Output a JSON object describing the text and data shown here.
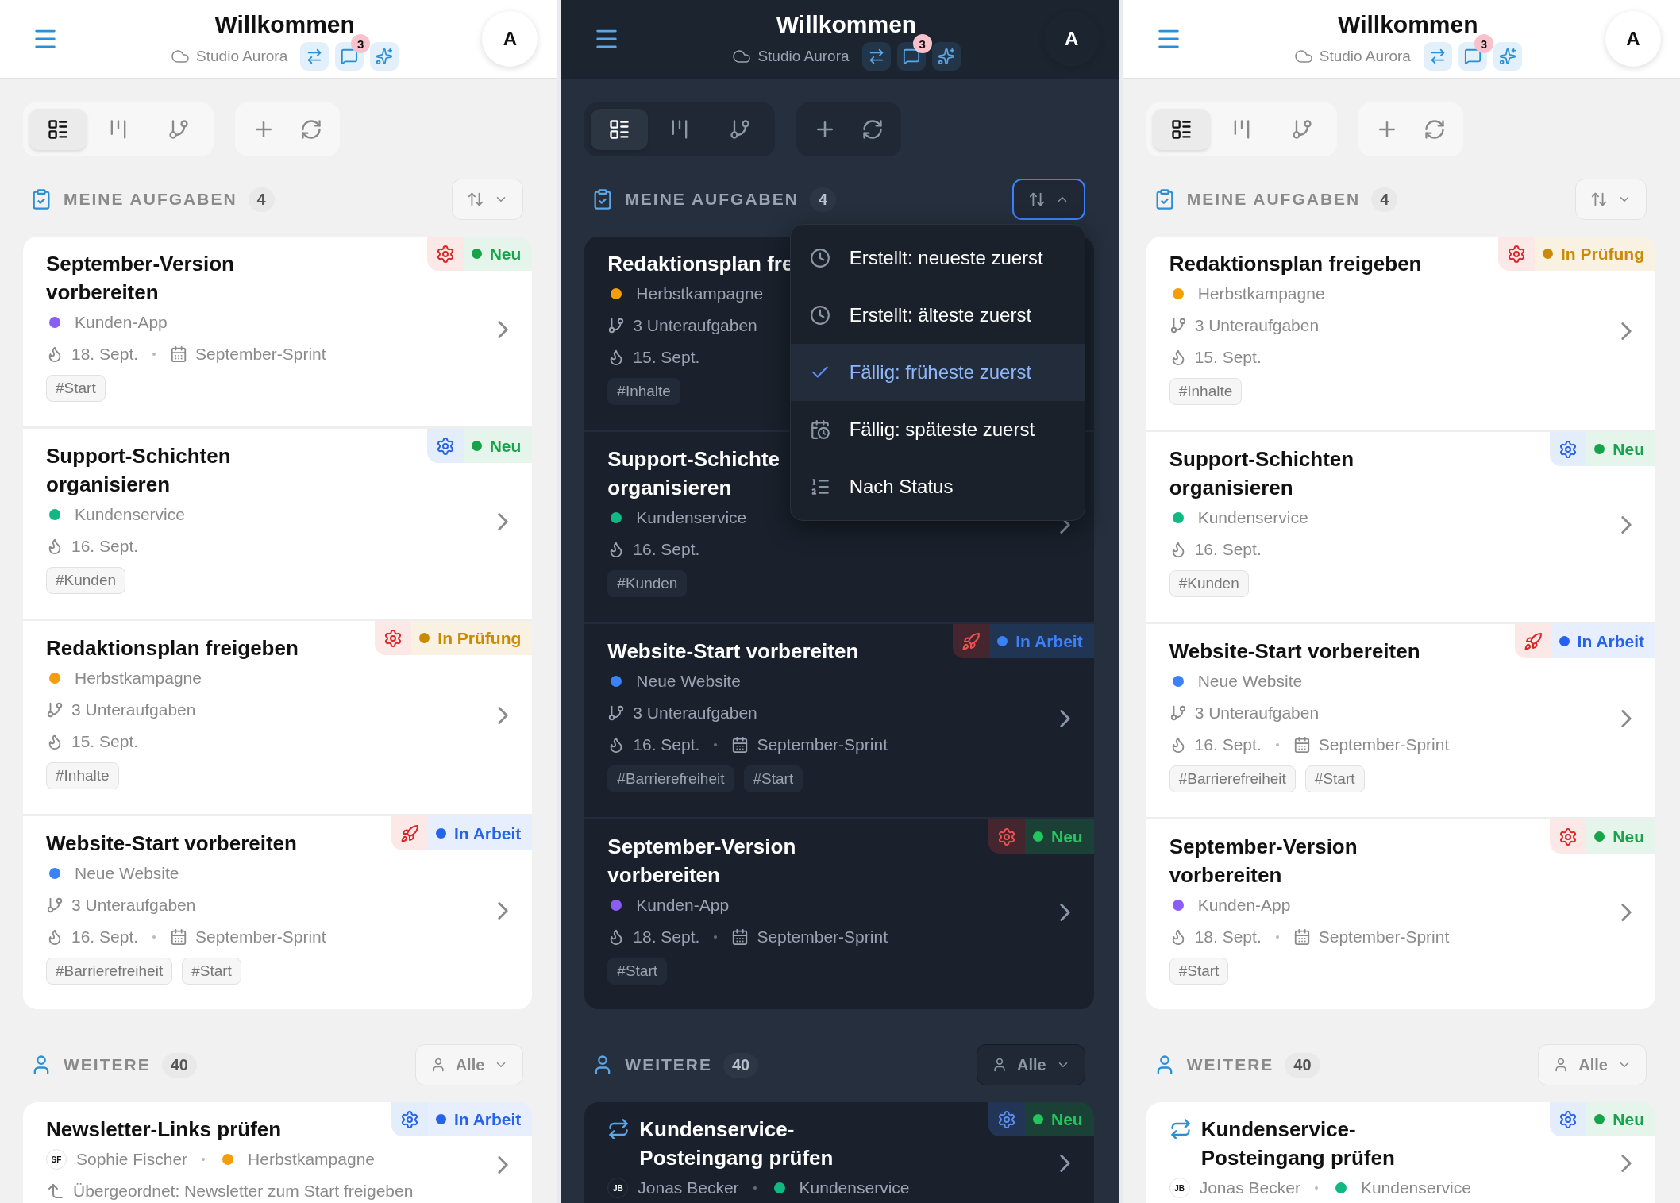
{
  "panels": [
    {
      "kind": "light",
      "header": {
        "title": "Willkommen",
        "workspace": "Studio Aurora",
        "message_count": "3",
        "avatar": "A"
      },
      "toolbar": {
        "views": [
          {
            "kind": "list",
            "selected": true
          },
          {
            "kind": "board",
            "selected": false
          },
          {
            "kind": "tree",
            "selected": false
          }
        ]
      },
      "my_tasks": {
        "title": "MEINE AUFGABEN",
        "count": "4",
        "sort": {
          "open": false
        }
      },
      "tasks": [
        {
          "title": "September-Version vorbereiten",
          "badge": {
            "urgent": true,
            "kind": "gear",
            "status": "Neu",
            "color": "#16a34a"
          },
          "project": {
            "name": "Kunden-App",
            "color": "#8b5cf6"
          },
          "due": "18. Sept.",
          "sprint": "September-Sprint",
          "tags": [
            "#Start"
          ]
        },
        {
          "title": "Support-Schichten organisieren",
          "badge": {
            "urgent": false,
            "kind": "gear",
            "status": "Neu",
            "color": "#16a34a"
          },
          "project": {
            "name": "Kundenservice",
            "color": "#10b981"
          },
          "due": "16. Sept.",
          "tags": [
            "#Kunden"
          ]
        },
        {
          "title": "Redaktionsplan freigeben",
          "badge": {
            "urgent": true,
            "kind": "gear",
            "status": "In Prüfung",
            "color": "#ca8a04"
          },
          "project": {
            "name": "Herbstkampagne",
            "color": "#f59e0b"
          },
          "subtasks": "3 Unteraufgaben",
          "due": "15. Sept.",
          "tags": [
            "#Inhalte"
          ]
        },
        {
          "title": "Website-Start vorbereiten",
          "badge": {
            "urgent": true,
            "kind": "rocket",
            "status": "In Arbeit",
            "color": "#2563eb"
          },
          "project": {
            "name": "Neue Website",
            "color": "#3b82f6"
          },
          "subtasks": "3 Unteraufgaben",
          "due": "16. Sept.",
          "sprint": "September-Sprint",
          "tags": [
            "#Barrierefreiheit",
            "#Start"
          ]
        }
      ],
      "others": {
        "title": "WEITERE",
        "count": "40",
        "filter": "Alle"
      },
      "other_tasks": [
        {
          "title": "Newsletter-Links prüfen",
          "badge": {
            "urgent": false,
            "kind": "gear",
            "status": "In Arbeit",
            "color": "#2563eb"
          },
          "assignee": {
            "initials": "SF",
            "name": "Sophie Fischer"
          },
          "project": {
            "name": "Herbstkampagne",
            "color": "#f59e0b"
          },
          "parent": "Übergeordnet: Newsletter zum Start freigeben"
        }
      ]
    },
    {
      "kind": "dark",
      "header": {
        "title": "Willkommen",
        "workspace": "Studio Aurora",
        "message_count": "3",
        "avatar": "A"
      },
      "toolbar": {
        "views": [
          {
            "kind": "list",
            "selected": true
          },
          {
            "kind": "board",
            "selected": false
          },
          {
            "kind": "tree",
            "selected": false
          }
        ]
      },
      "my_tasks": {
        "title": "MEINE AUFGABEN",
        "count": "4",
        "sort": {
          "open": true,
          "options": [
            {
              "label": "Erstellt: neueste zuerst",
              "kind": "clock",
              "selected": false
            },
            {
              "label": "Erstellt: älteste zuerst",
              "kind": "clock",
              "selected": false
            },
            {
              "label": "Fällig: früheste zuerst",
              "selected": true
            },
            {
              "label": "Fällig: späteste zuerst",
              "kind": "calendar",
              "selected": false
            },
            {
              "label": "Nach Status",
              "kind": "list",
              "selected": false
            }
          ]
        }
      },
      "tasks": [
        {
          "title": "Redaktionsplan fre",
          "chevron_hidden": true,
          "project": {
            "name": "Herbstkampagne",
            "color": "#f59e0b"
          },
          "subtasks": "3 Unteraufgaben",
          "due": "15. Sept.",
          "tags": [
            "#Inhalte"
          ]
        },
        {
          "title": "Support-Schichte\norganisieren",
          "project": {
            "name": "Kundenservice",
            "color": "#10b981"
          },
          "due": "16. Sept.",
          "tags": [
            "#Kunden"
          ]
        },
        {
          "title": "Website-Start vorbereiten",
          "badge": {
            "urgent": true,
            "kind": "rocket",
            "status": "In Arbeit",
            "color": "#3b82f6"
          },
          "project": {
            "name": "Neue Website",
            "color": "#3b82f6"
          },
          "subtasks": "3 Unteraufgaben",
          "due": "16. Sept.",
          "sprint": "September-Sprint",
          "tags": [
            "#Barrierefreiheit",
            "#Start"
          ]
        },
        {
          "title": "September-Version vorbereiten",
          "badge": {
            "urgent": true,
            "kind": "gear",
            "status": "Neu",
            "color": "#22c55e"
          },
          "project": {
            "name": "Kunden-App",
            "color": "#8b5cf6"
          },
          "due": "18. Sept.",
          "sprint": "September-Sprint",
          "tags": [
            "#Start"
          ]
        }
      ],
      "others": {
        "title": "WEITERE",
        "count": "40",
        "filter": "Alle"
      },
      "other_tasks": [
        {
          "title": "Kundenservice-Posteingang prüfen",
          "recurring": true,
          "badge": {
            "urgent": false,
            "kind": "gear",
            "status": "Neu",
            "color": "#22c55e"
          },
          "assignee": {
            "initials": "JB",
            "name": "Jonas Becker"
          },
          "project": {
            "name": "Kundenservice",
            "color": "#10b981"
          }
        }
      ]
    },
    {
      "kind": "light",
      "header": {
        "title": "Willkommen",
        "workspace": "Studio Aurora",
        "message_count": "3",
        "avatar": "A"
      },
      "toolbar": {
        "views": [
          {
            "kind": "list",
            "selected": true
          },
          {
            "kind": "board",
            "selected": false
          },
          {
            "kind": "tree",
            "selected": false
          }
        ]
      },
      "my_tasks": {
        "title": "MEINE AUFGABEN",
        "count": "4",
        "sort": {
          "open": false
        }
      },
      "tasks": [
        {
          "title": "Redaktionsplan freigeben",
          "badge": {
            "urgent": true,
            "kind": "gear",
            "status": "In Prüfung",
            "color": "#ca8a04"
          },
          "project": {
            "name": "Herbstkampagne",
            "color": "#f59e0b"
          },
          "subtasks": "3 Unteraufgaben",
          "due": "15. Sept.",
          "tags": [
            "#Inhalte"
          ]
        },
        {
          "title": "Support-Schichten organisieren",
          "badge": {
            "urgent": false,
            "kind": "gear",
            "status": "Neu",
            "color": "#16a34a"
          },
          "project": {
            "name": "Kundenservice",
            "color": "#10b981"
          },
          "due": "16. Sept.",
          "tags": [
            "#Kunden"
          ]
        },
        {
          "title": "Website-Start vorbereiten",
          "badge": {
            "urgent": true,
            "kind": "rocket",
            "status": "In Arbeit",
            "color": "#2563eb"
          },
          "project": {
            "name": "Neue Website",
            "color": "#3b82f6"
          },
          "subtasks": "3 Unteraufgaben",
          "due": "16. Sept.",
          "sprint": "September-Sprint",
          "tags": [
            "#Barrierefreiheit",
            "#Start"
          ]
        },
        {
          "title": "September-Version vorbereiten",
          "badge": {
            "urgent": true,
            "kind": "gear",
            "status": "Neu",
            "color": "#16a34a"
          },
          "project": {
            "name": "Kunden-App",
            "color": "#8b5cf6"
          },
          "due": "18. Sept.",
          "sprint": "September-Sprint",
          "tags": [
            "#Start"
          ]
        }
      ],
      "others": {
        "title": "WEITERE",
        "count": "40",
        "filter": "Alle"
      },
      "other_tasks": [
        {
          "title": "Kundenservice-Posteingang prüfen",
          "recurring": true,
          "badge": {
            "urgent": false,
            "kind": "gear",
            "status": "Neu",
            "color": "#16a34a"
          },
          "assignee": {
            "initials": "JB",
            "name": "Jonas Becker"
          },
          "project": {
            "name": "Kundenservice",
            "color": "#10b981"
          }
        }
      ]
    }
  ]
}
